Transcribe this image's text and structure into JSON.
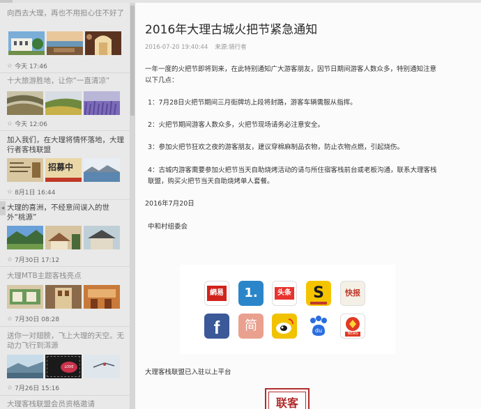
{
  "sidebar": {
    "items": [
      {
        "title": "向西去大理，再也不用担心住不好了",
        "time": "今天 17:46"
      },
      {
        "title": "十大旅游胜地，让你“一直清凉“",
        "time": "今天 12:06"
      },
      {
        "title": "加入我们，在大理将情怀落地，大理行者客栈联盟",
        "time": "8月1日 16:44",
        "banner_text": "招募中"
      },
      {
        "title": "大理的喜洲，不经意间误入的世外“桃源”",
        "time": "7月30日 17:12"
      },
      {
        "title": "大理MTB主题客栈亮点",
        "time": "7月30日 08:28"
      },
      {
        "title": "送你一对翅膀，飞上大理的天空。无动力飞行到洱源",
        "time": "7月26日 15:16",
        "badge_text": "LOVE"
      },
      {
        "title": "大理客栈联盟会员资格邀请"
      }
    ]
  },
  "article": {
    "title": "2016年大理古城火把节紧急通知",
    "date": "2016-07-20 19:40:44",
    "source": "来源:骑行者",
    "intro": "一年一度的火把节即将到来，在此特别通知广大游客朋友，因节日期间游客人数众多，特别通知注意以下几点：",
    "points": [
      "1：7月28日火把节期间三月街牌坊上段将封路，游客车辆需服从指挥。",
      "2：火把节期间游客人数众多，火把节现场请务必注意安全。",
      "3：参加火把节狂欢之夜的游客朋友，建议穿棉麻制品衣物，防止衣物点燃，引起烧伤。",
      "4：古城内游客需要参加火把节当天自助烧烤活动的请与所住宿客栈前台或老板沟通，联系大理客栈联盟，购买火把节当天自助烧烤单人套餐。"
    ],
    "date_line": "2016年7月20日",
    "signature": "中和村组委会",
    "platforms_note": "大理客栈联盟已入驻以上平台",
    "seal_text": "联客"
  },
  "apps": [
    {
      "name": "netease-news-icon",
      "label": "網易",
      "color": "#d0231c"
    },
    {
      "name": "yidian-icon",
      "label": "1.",
      "color": "#2a86c9"
    },
    {
      "name": "toutiao-icon",
      "label": "头条",
      "color": "#e8332f"
    },
    {
      "name": "sohu-icon",
      "label": "S",
      "color": "#f5c400"
    },
    {
      "name": "kuaibao-icon",
      "label": "快报",
      "color": "#f4f0e6"
    },
    {
      "name": "facebook-icon",
      "label": "f",
      "color": "#3b5998"
    },
    {
      "name": "jian-icon",
      "label": "简",
      "color": "#e9a08f"
    },
    {
      "name": "weibo-icon",
      "label": "weibo",
      "color": "#f1c200"
    },
    {
      "name": "baidu-icon",
      "label": "du",
      "color": "#2a6ee0"
    },
    {
      "name": "people-news-icon",
      "label": "NEWS",
      "color": "#e03a24"
    }
  ]
}
